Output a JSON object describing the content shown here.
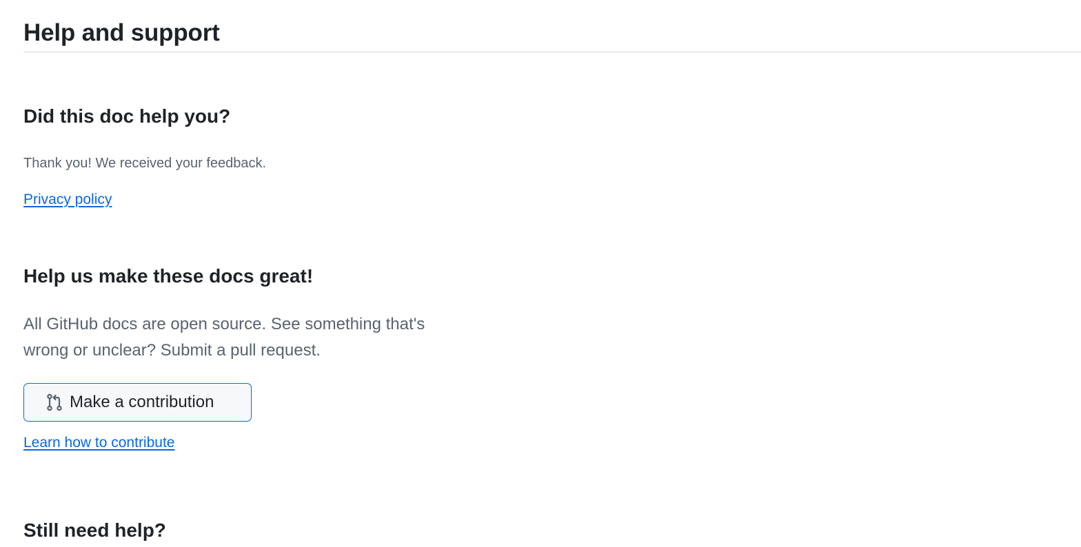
{
  "page": {
    "title": "Help and support"
  },
  "feedback": {
    "heading": "Did this doc help you?",
    "thanks_message": "Thank you! We received your feedback.",
    "privacy_link": "Privacy policy"
  },
  "contribute": {
    "heading": "Help us make these docs great!",
    "description": "All GitHub docs are open source. See something that's wrong or unclear? Submit a pull request.",
    "button_label": "Make a contribution",
    "button_icon": "git-pull-request-icon",
    "learn_link": "Learn how to contribute"
  },
  "support": {
    "heading": "Still need help?"
  },
  "colors": {
    "link": "#0969da",
    "text": "#1f2328",
    "muted": "#59636e",
    "divider": "#d1d9e0",
    "button_bg": "#f6f8fa",
    "button_border": "#0969da"
  }
}
